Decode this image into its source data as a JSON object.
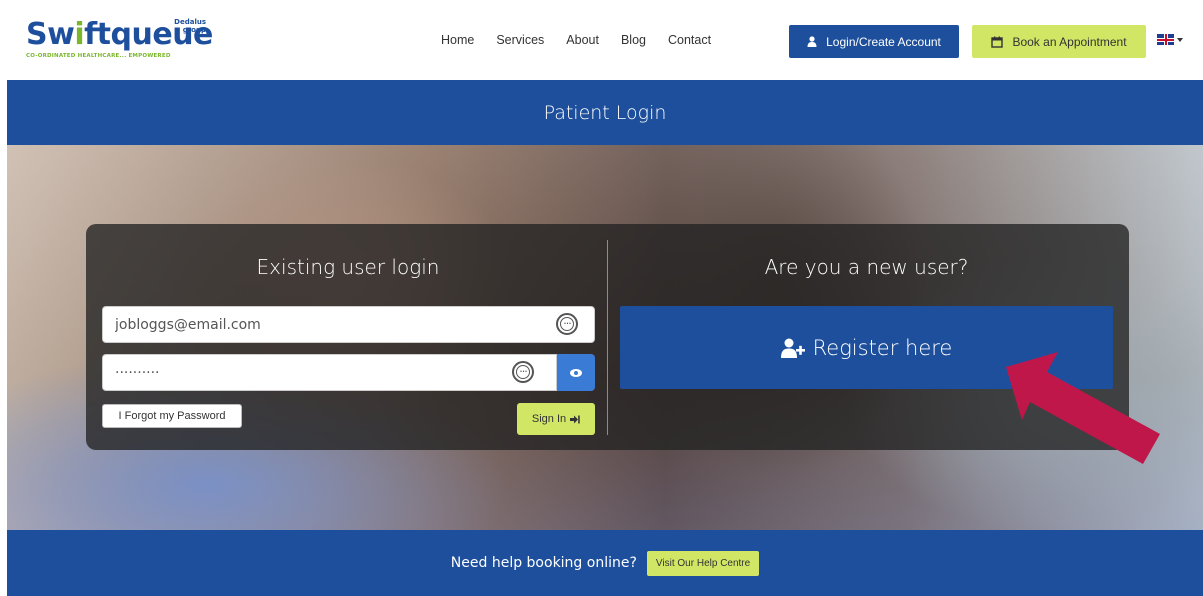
{
  "header": {
    "logo": {
      "wordmark_a": "Sw",
      "wordmark_b": "ftqueue",
      "group": "Dedalus group",
      "tagline": "CO-ORDINATED HEALTHCARE... EMPOWERED"
    },
    "nav": [
      "Home",
      "Services",
      "About",
      "Blog",
      "Contact"
    ],
    "login_label": "Login/Create Account",
    "book_label": "Book an Appointment",
    "language": "en-GB"
  },
  "page_title": "Patient Login",
  "login": {
    "title": "Existing user login",
    "email_value": "jobloggs@email.com",
    "password_value": "··········",
    "forgot_label": "I Forgot my Password",
    "signin_label": "Sign In"
  },
  "register": {
    "title": "Are you a new user?",
    "button_label": "Register here"
  },
  "footer": {
    "text": "Need help booking online?",
    "help_label": "Visit Our Help Centre"
  },
  "colors": {
    "brand_blue": "#1d4f9c",
    "brand_green": "#d2e666",
    "arrow": "#c0174a"
  }
}
